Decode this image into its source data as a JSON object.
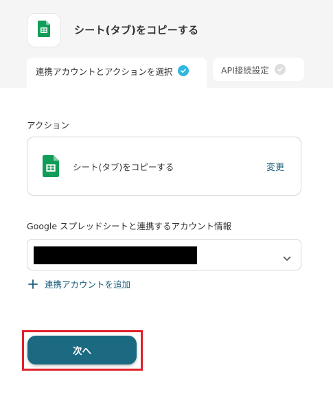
{
  "header": {
    "title": "シート(タブ)をコピーする",
    "app_icon": "google-sheets-icon"
  },
  "tabs": [
    {
      "label": "連携アカウントとアクションを選択",
      "status": "complete"
    },
    {
      "label": "API接続設定",
      "status": "pending"
    }
  ],
  "action_section": {
    "label": "アクション",
    "action_name": "シート(タブ)をコピーする",
    "change_label": "変更"
  },
  "account_section": {
    "label": "Google スプレッドシートと連携するアカウント情報",
    "selected_value": "",
    "add_account_label": "連携アカウントを追加"
  },
  "footer": {
    "next_label": "次へ"
  },
  "colors": {
    "accent": "#1c6a82",
    "link": "#1c5e7a",
    "check_done": "#2fb7e0",
    "highlight": "#e0202a",
    "sheets_green": "#0f9d58"
  }
}
